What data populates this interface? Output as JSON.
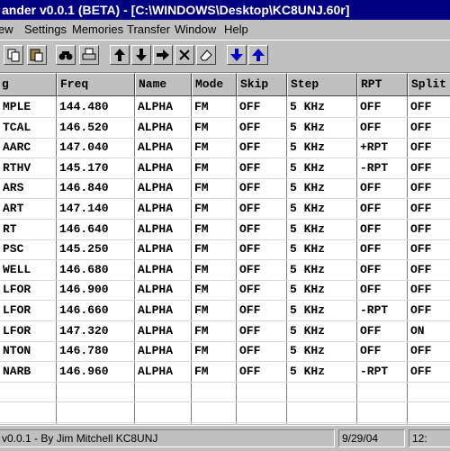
{
  "window": {
    "title": "ander v0.0.1 (BETA) - [C:\\WINDOWS\\Desktop\\KC8UNJ.60r]"
  },
  "menu": [
    {
      "label": "ew"
    },
    {
      "label": "Settings"
    },
    {
      "label": "Memories"
    },
    {
      "label": "Transfer"
    },
    {
      "label": "Window"
    },
    {
      "label": "Help"
    }
  ],
  "toolbar": {
    "icons": [
      "copy-icon",
      "paste-icon",
      "find-icon",
      "print-icon",
      "move-up-icon",
      "move-down-icon",
      "move-right-icon",
      "delete-icon",
      "erase-icon",
      "download-icon",
      "upload-icon"
    ]
  },
  "table": {
    "columns": [
      "g",
      "Freq",
      "Name",
      "Mode",
      "Skip",
      "Step",
      "RPT",
      "Split"
    ],
    "rows": [
      [
        "MPLE",
        "144.480",
        "ALPHA",
        "FM",
        "OFF",
        "5 KHz",
        "OFF",
        "OFF"
      ],
      [
        "TCAL",
        "146.520",
        "ALPHA",
        "FM",
        "OFF",
        "5 KHz",
        "OFF",
        "OFF"
      ],
      [
        "AARC",
        "147.040",
        "ALPHA",
        "FM",
        "OFF",
        "5 KHz",
        "+RPT",
        "OFF"
      ],
      [
        "RTHV",
        "145.170",
        "ALPHA",
        "FM",
        "OFF",
        "5 KHz",
        "-RPT",
        "OFF"
      ],
      [
        "ARS",
        "146.840",
        "ALPHA",
        "FM",
        "OFF",
        "5 KHz",
        "OFF",
        "OFF"
      ],
      [
        "ART",
        "147.140",
        "ALPHA",
        "FM",
        "OFF",
        "5 KHz",
        "OFF",
        "OFF"
      ],
      [
        "RT",
        "146.640",
        "ALPHA",
        "FM",
        "OFF",
        "5 KHz",
        "OFF",
        "OFF"
      ],
      [
        "PSC",
        "145.250",
        "ALPHA",
        "FM",
        "OFF",
        "5 KHz",
        "OFF",
        "OFF"
      ],
      [
        "WELL",
        "146.680",
        "ALPHA",
        "FM",
        "OFF",
        "5 KHz",
        "OFF",
        "OFF"
      ],
      [
        "LFOR",
        "146.900",
        "ALPHA",
        "FM",
        "OFF",
        "5 KHz",
        "OFF",
        "OFF"
      ],
      [
        "LFOR",
        "146.660",
        "ALPHA",
        "FM",
        "OFF",
        "5 KHz",
        "-RPT",
        "OFF"
      ],
      [
        "LFOR",
        "147.320",
        "ALPHA",
        "FM",
        "OFF",
        "5 KHz",
        "OFF",
        "ON"
      ],
      [
        "NTON",
        "146.780",
        "ALPHA",
        "FM",
        "OFF",
        "5 KHz",
        "OFF",
        "OFF"
      ],
      [
        "NARB",
        "146.960",
        "ALPHA",
        "FM",
        "OFF",
        "5 KHz",
        "-RPT",
        "OFF"
      ]
    ]
  },
  "status": {
    "left": "v0.0.1 - By Jim Mitchell KC8UNJ",
    "date": "9/29/04",
    "time": "12:"
  }
}
